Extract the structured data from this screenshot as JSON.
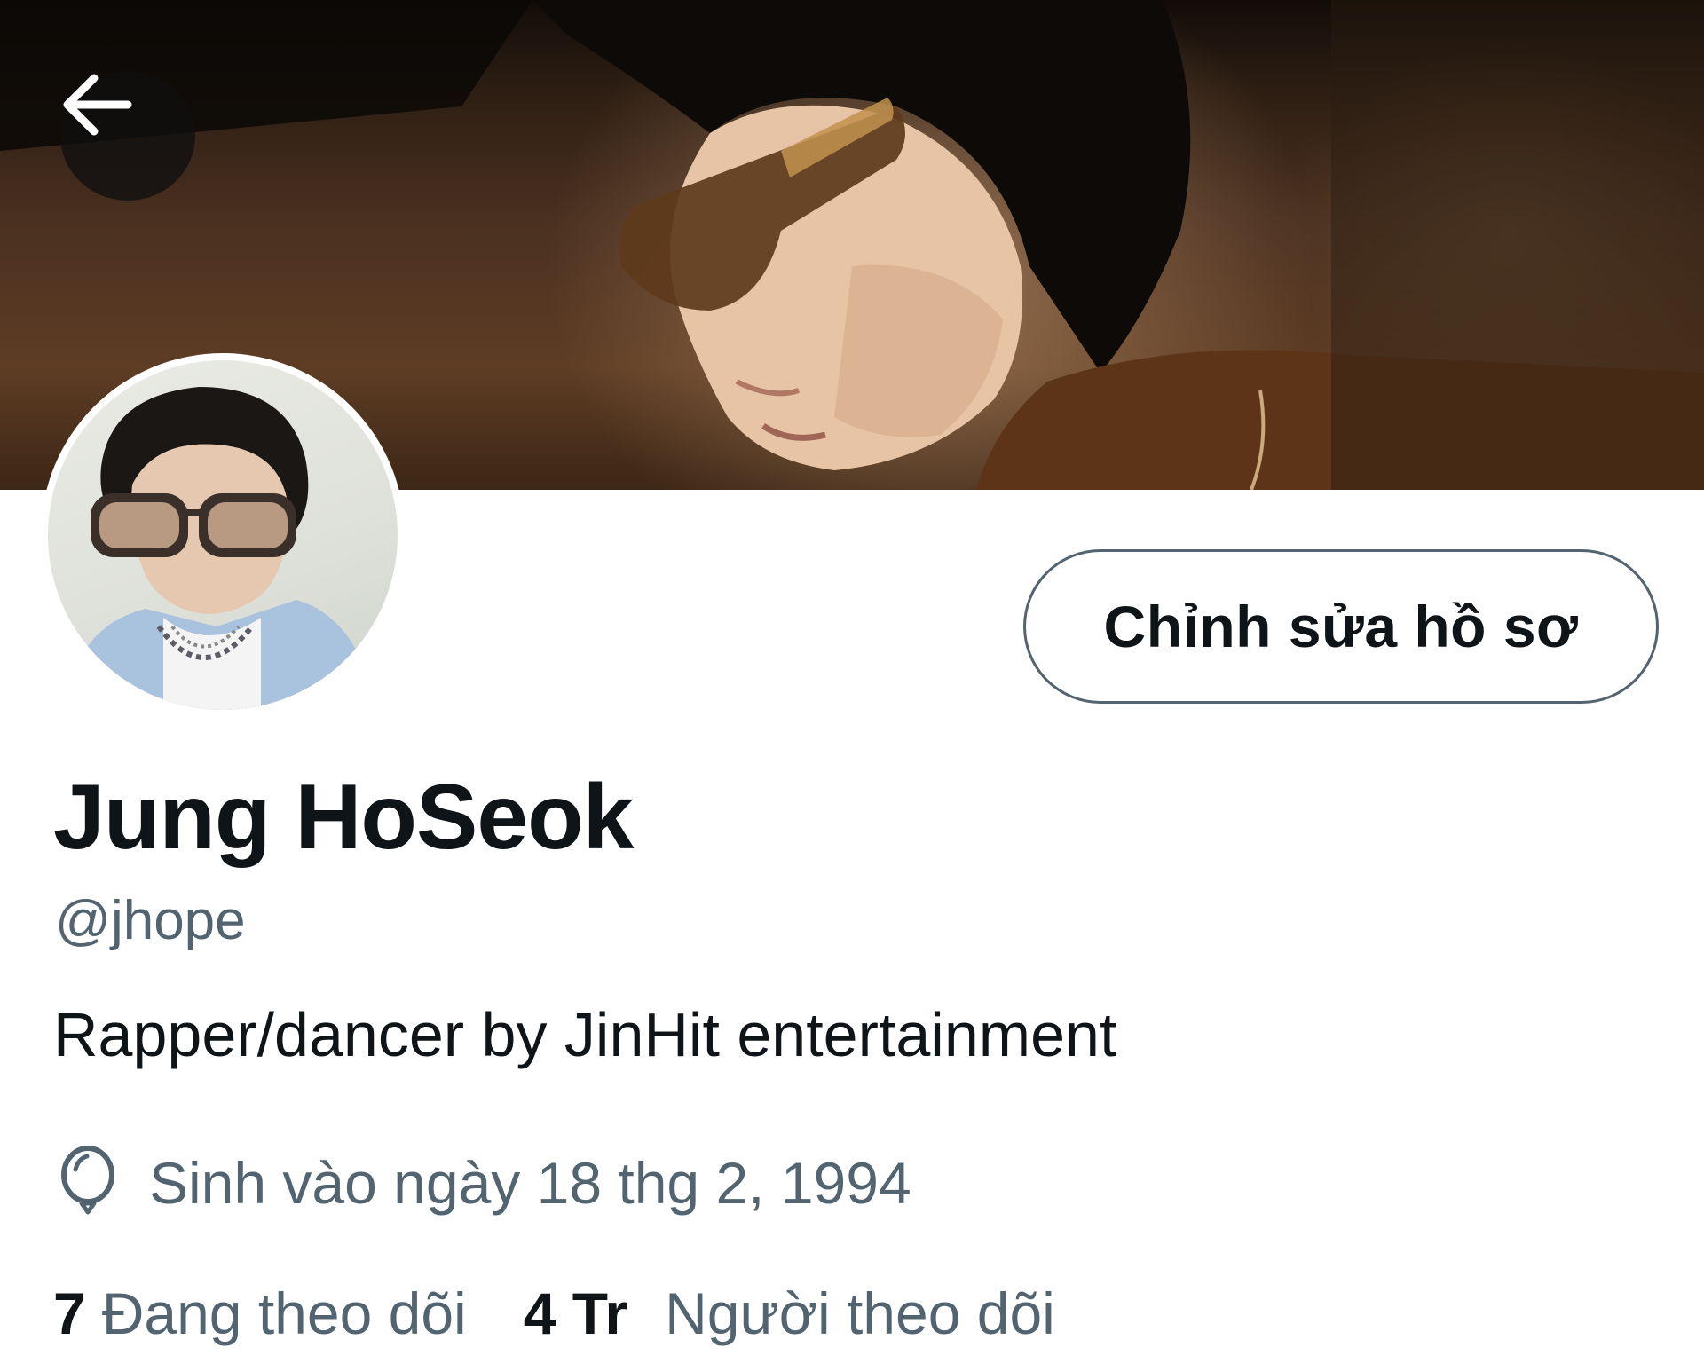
{
  "header": {
    "back_icon": "arrow-left-icon",
    "banner_image": "profile-banner"
  },
  "profile": {
    "avatar": "profile-avatar",
    "edit_button_label": "Chỉnh sửa hồ sơ",
    "display_name": "Jung HoSeok",
    "handle": "@jhope",
    "bio": "Rapper/dancer by JinHit entertainment",
    "birth_icon": "balloon-icon",
    "birth_date": "Sinh vào ngày 18 thg 2, 1994"
  },
  "stats": {
    "following_count": "7",
    "following_label": "Đang theo dõi",
    "followers_count": "4 Tr",
    "followers_label": "Người theo dõi"
  },
  "colors": {
    "text_primary": "#0f1419",
    "text_secondary": "#536471",
    "button_border": "#536471"
  }
}
